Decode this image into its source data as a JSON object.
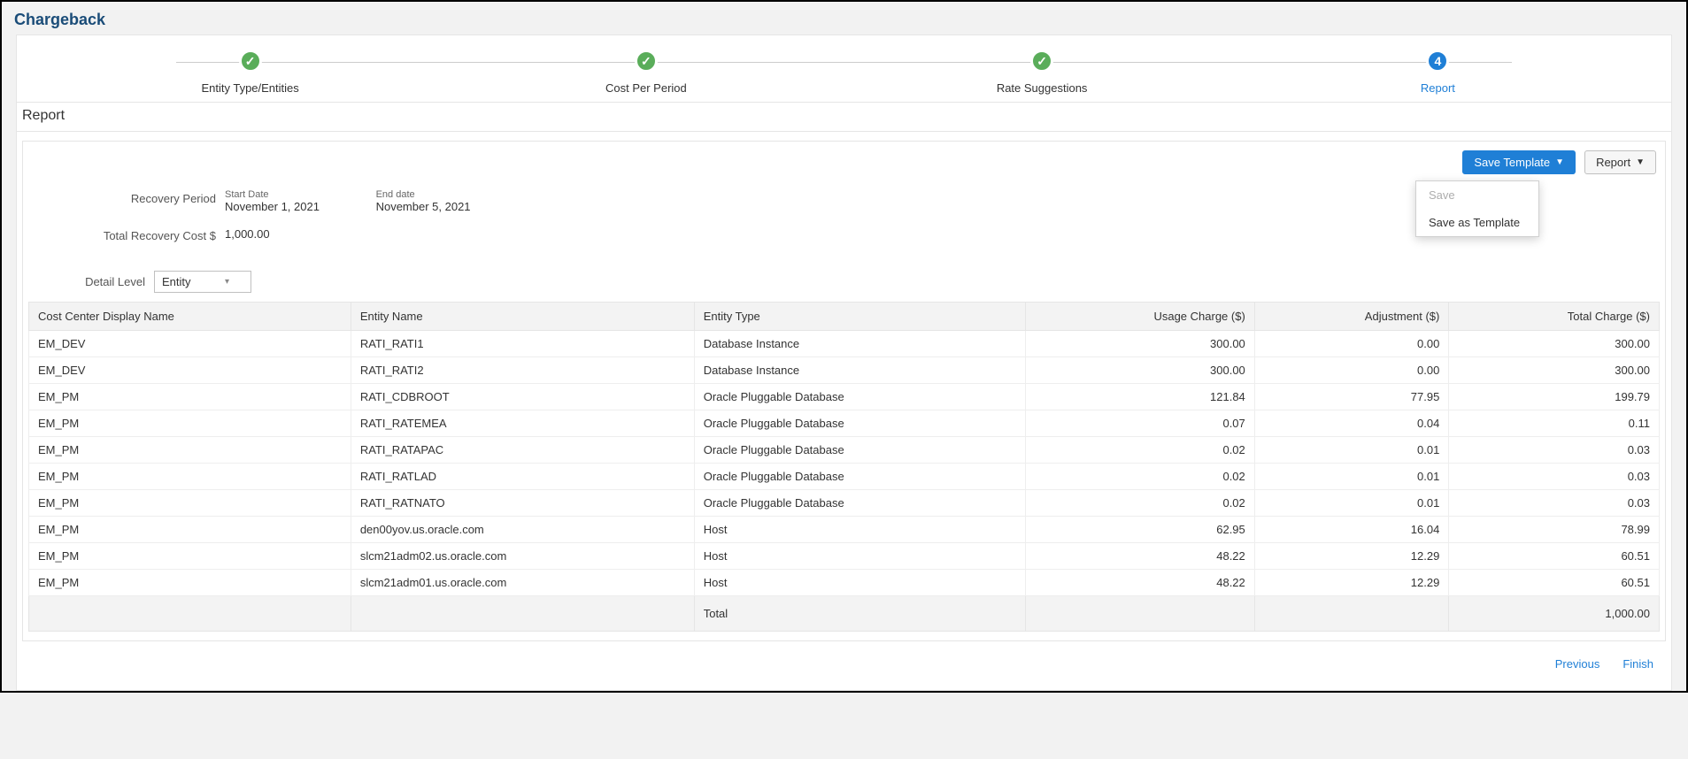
{
  "page": {
    "title": "Chargeback",
    "section": "Report"
  },
  "stepper": {
    "steps": [
      {
        "label": "Entity Type/Entities",
        "state": "done",
        "mark": "✓"
      },
      {
        "label": "Cost Per Period",
        "state": "done",
        "mark": "✓"
      },
      {
        "label": "Rate Suggestions",
        "state": "done",
        "mark": "✓"
      },
      {
        "label": "Report",
        "state": "current",
        "mark": "4"
      }
    ]
  },
  "toolbar": {
    "save_template": "Save Template",
    "report": "Report",
    "menu": {
      "save": "Save",
      "save_as_template": "Save as Template"
    }
  },
  "info": {
    "recovery_period_label": "Recovery Period",
    "start_label": "Start Date",
    "start_value": "November 1, 2021",
    "end_label": "End date",
    "end_value": "November 5, 2021",
    "total_cost_label": "Total Recovery Cost $",
    "total_cost_value": "1,000.00"
  },
  "detail": {
    "label": "Detail Level",
    "value": "Entity"
  },
  "table": {
    "headers": {
      "cost_center": "Cost Center Display Name",
      "entity_name": "Entity Name",
      "entity_type": "Entity Type",
      "usage_charge": "Usage Charge ($)",
      "adjustment": "Adjustment ($)",
      "total_charge": "Total Charge ($)"
    },
    "rows": [
      {
        "cost_center": "EM_DEV",
        "entity_name": "RATI_RATI1",
        "entity_type": "Database Instance",
        "usage": "300.00",
        "adj": "0.00",
        "total": "300.00"
      },
      {
        "cost_center": "EM_DEV",
        "entity_name": "RATI_RATI2",
        "entity_type": "Database Instance",
        "usage": "300.00",
        "adj": "0.00",
        "total": "300.00"
      },
      {
        "cost_center": "EM_PM",
        "entity_name": "RATI_CDBROOT",
        "entity_type": "Oracle Pluggable Database",
        "usage": "121.84",
        "adj": "77.95",
        "total": "199.79"
      },
      {
        "cost_center": "EM_PM",
        "entity_name": "RATI_RATEMEA",
        "entity_type": "Oracle Pluggable Database",
        "usage": "0.07",
        "adj": "0.04",
        "total": "0.11"
      },
      {
        "cost_center": "EM_PM",
        "entity_name": "RATI_RATAPAC",
        "entity_type": "Oracle Pluggable Database",
        "usage": "0.02",
        "adj": "0.01",
        "total": "0.03"
      },
      {
        "cost_center": "EM_PM",
        "entity_name": "RATI_RATLAD",
        "entity_type": "Oracle Pluggable Database",
        "usage": "0.02",
        "adj": "0.01",
        "total": "0.03"
      },
      {
        "cost_center": "EM_PM",
        "entity_name": "RATI_RATNATO",
        "entity_type": "Oracle Pluggable Database",
        "usage": "0.02",
        "adj": "0.01",
        "total": "0.03"
      },
      {
        "cost_center": "EM_PM",
        "entity_name": "den00yov.us.oracle.com",
        "entity_type": "Host",
        "usage": "62.95",
        "adj": "16.04",
        "total": "78.99"
      },
      {
        "cost_center": "EM_PM",
        "entity_name": "slcm21adm02.us.oracle.com",
        "entity_type": "Host",
        "usage": "48.22",
        "adj": "12.29",
        "total": "60.51"
      },
      {
        "cost_center": "EM_PM",
        "entity_name": "slcm21adm01.us.oracle.com",
        "entity_type": "Host",
        "usage": "48.22",
        "adj": "12.29",
        "total": "60.51"
      }
    ],
    "footer": {
      "label": "Total",
      "total": "1,000.00"
    }
  },
  "footer_nav": {
    "previous": "Previous",
    "finish": "Finish"
  }
}
